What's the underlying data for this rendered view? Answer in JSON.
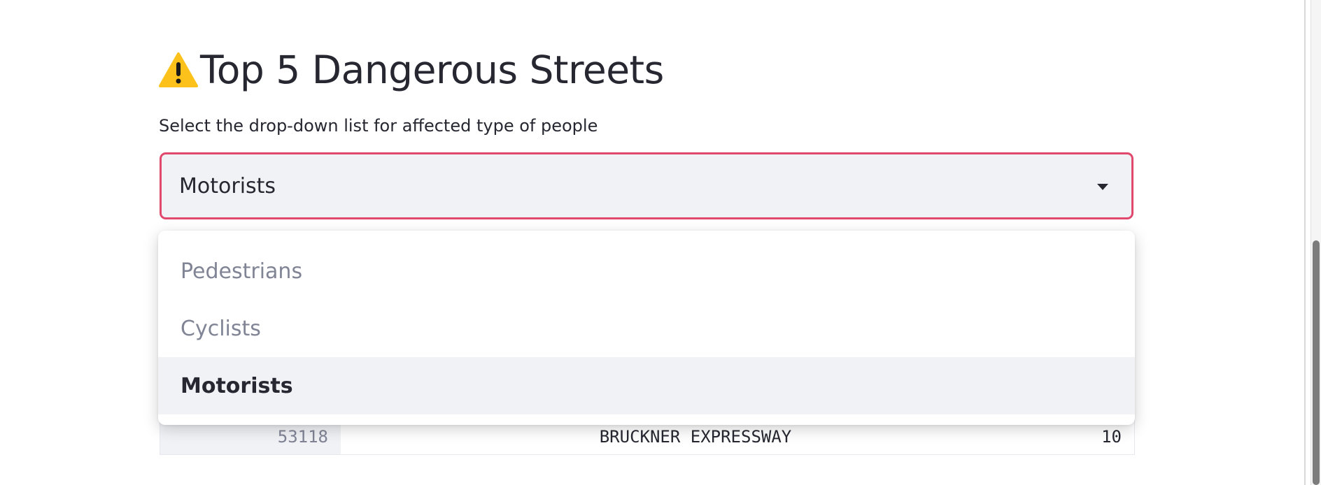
{
  "page": {
    "title": "Top 5 Dangerous Streets",
    "title_icon": "warning-icon"
  },
  "select": {
    "label": "Select the drop-down list for affected type of people",
    "value": "Motorists",
    "options": [
      "Pedestrians",
      "Cyclists",
      "Motorists"
    ],
    "selected_index": 2
  },
  "table": {
    "rows": [
      {
        "index": "53118",
        "street": "BRUCKNER EXPRESSWAY",
        "count": "10"
      }
    ]
  },
  "colors": {
    "focus_border": "#e0486d",
    "select_bg": "#f0f2f6",
    "text": "#262730",
    "muted_text": "#808495"
  }
}
